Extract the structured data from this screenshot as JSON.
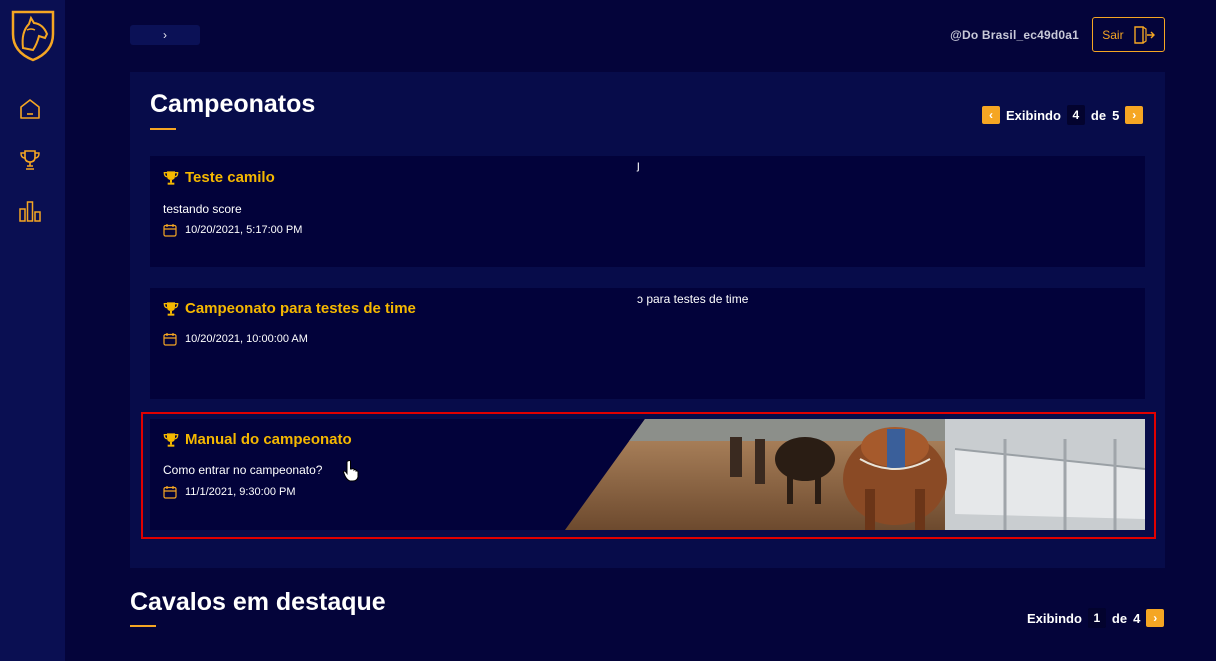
{
  "sidebar": {
    "logo": "horse-head-shield-logo",
    "items": [
      {
        "icon": "home-icon"
      },
      {
        "icon": "trophy-icon"
      },
      {
        "icon": "bar-chart-icon"
      }
    ]
  },
  "header": {
    "breadcrumb_separator": "›",
    "username": "@Do Brasil_ec49d0a1",
    "logout_label": "Sair"
  },
  "championships": {
    "title": "Campeonatos",
    "pager": {
      "prefix": "Exibindo",
      "current": "4",
      "of_label": "de",
      "total": "5"
    },
    "items": [
      {
        "title": "Teste camilo",
        "description": "testando score",
        "date": "10/20/2021, 5:17:00 PM",
        "stray_text": "ȷ"
      },
      {
        "title": "Campeonato para testes de time",
        "description": "",
        "date": "10/20/2021, 10:00:00 AM",
        "stray_text": "ɔ para testes de time"
      },
      {
        "title": "Manual do campeonato",
        "description": "Como entrar no campeonato?",
        "date": "11/1/2021, 9:30:00 PM"
      }
    ]
  },
  "featured_horses": {
    "title": "Cavalos em destaque",
    "pager": {
      "prefix": "Exibindo",
      "current": "1",
      "of_label": "de",
      "total": "4"
    }
  },
  "colors": {
    "accent": "#f5a623",
    "title_yellow": "#f5b800",
    "background": "#04043a",
    "highlight": "#e00000"
  }
}
